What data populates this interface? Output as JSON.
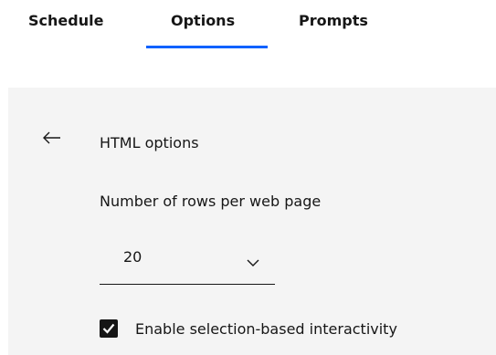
{
  "tabs": [
    {
      "label": "Schedule",
      "selected": false
    },
    {
      "label": "Options",
      "selected": true
    },
    {
      "label": "Prompts",
      "selected": false
    }
  ],
  "accent_color": "#0f62fe",
  "panel": {
    "back_icon": "arrow-left-icon",
    "title": "HTML options",
    "rows_label": "Number of rows per web page",
    "rows_value": "20",
    "checkbox_label": "Enable selection-based interactivity",
    "checkbox_checked": true
  }
}
